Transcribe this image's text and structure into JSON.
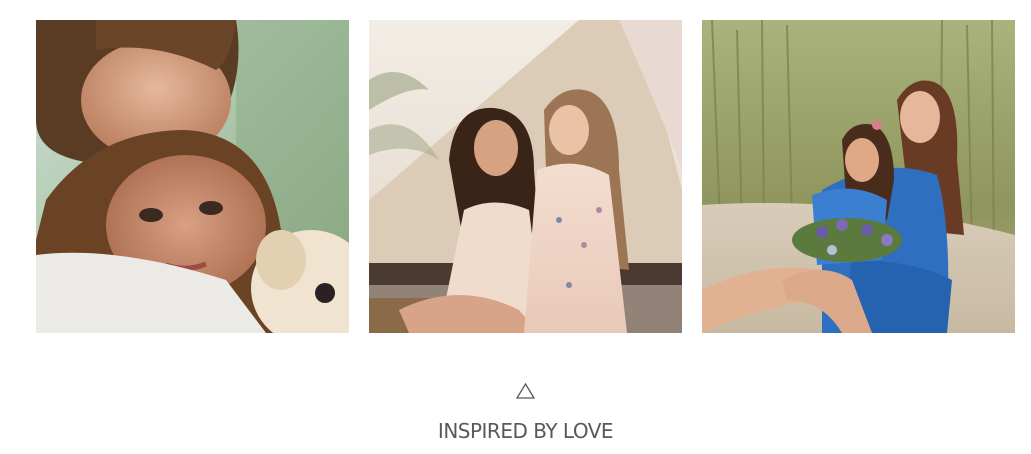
{
  "gallery": {
    "photos": [
      {
        "id": "mother-daughter-puppy",
        "icon": "photo"
      },
      {
        "id": "mother-braiding-hair",
        "icon": "photo"
      },
      {
        "id": "mother-daughter-reeds",
        "icon": "photo"
      }
    ]
  },
  "section": {
    "icon": "triangle-outline-icon",
    "icon_color": "#55595b",
    "title": "INSPIRED BY LOVE",
    "title_color": "#555a5c"
  }
}
